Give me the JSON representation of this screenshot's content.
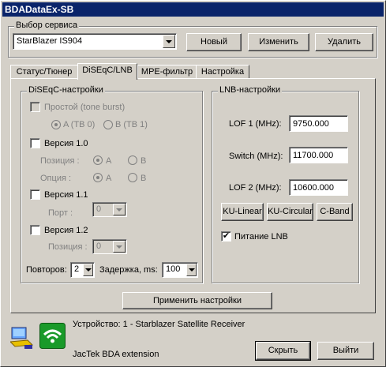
{
  "window": {
    "title": "BDADataEx-SB"
  },
  "service": {
    "group_label": "Выбор сервиса",
    "selected": "StarBlazer IS904",
    "new_label": "Новый",
    "edit_label": "Изменить",
    "delete_label": "Удалить"
  },
  "tabs": [
    {
      "label": "Статус/Тюнер",
      "active": false
    },
    {
      "label": "DiSEqC/LNB",
      "active": true
    },
    {
      "label": "MPE-фильтр",
      "active": false
    },
    {
      "label": "Настройка",
      "active": false
    }
  ],
  "diseqc": {
    "group_label": "DiSEqC-настройки",
    "simple_label": "Простой (tone burst)",
    "radio_a_tb0": "A (TB 0)",
    "radio_b_tb1": "B (TB 1)",
    "v10_label": "Версия 1.0",
    "position_label": "Позиция :",
    "option_label": "Опция :",
    "radio_a": "A",
    "radio_b": "B",
    "v11_label": "Версия 1.1",
    "port_label": "Порт :",
    "port_value": "0",
    "v12_label": "Версия 1.2",
    "position12_label": "Позиция :",
    "position12_value": "0",
    "repeats_label": "Повторов:",
    "repeats_value": "2",
    "delay_label": "Задержка, ms:",
    "delay_value": "100"
  },
  "lnb": {
    "group_label": "LNB-настройки",
    "lof1_label": "LOF 1 (MHz):",
    "lof1_value": "9750.000",
    "switch_label": "Switch (MHz):",
    "switch_value": "11700.000",
    "lof2_label": "LOF 2 (MHz):",
    "lof2_value": "10600.000",
    "ku_linear": "KU-Linear",
    "ku_circular": "KU-Circular",
    "c_band": "C-Band",
    "power_label": "Питание LNB",
    "power_checked": true
  },
  "apply_label": "Применить настройки",
  "footer": {
    "device_text": "Устройство: 1 - Starblazer Satellite Receiver",
    "extension_text": "JacTek BDA extension",
    "hide_label": "Скрыть",
    "exit_label": "Выйти",
    "icons": [
      "computer-network-icon",
      "wifi-signal-icon"
    ]
  }
}
